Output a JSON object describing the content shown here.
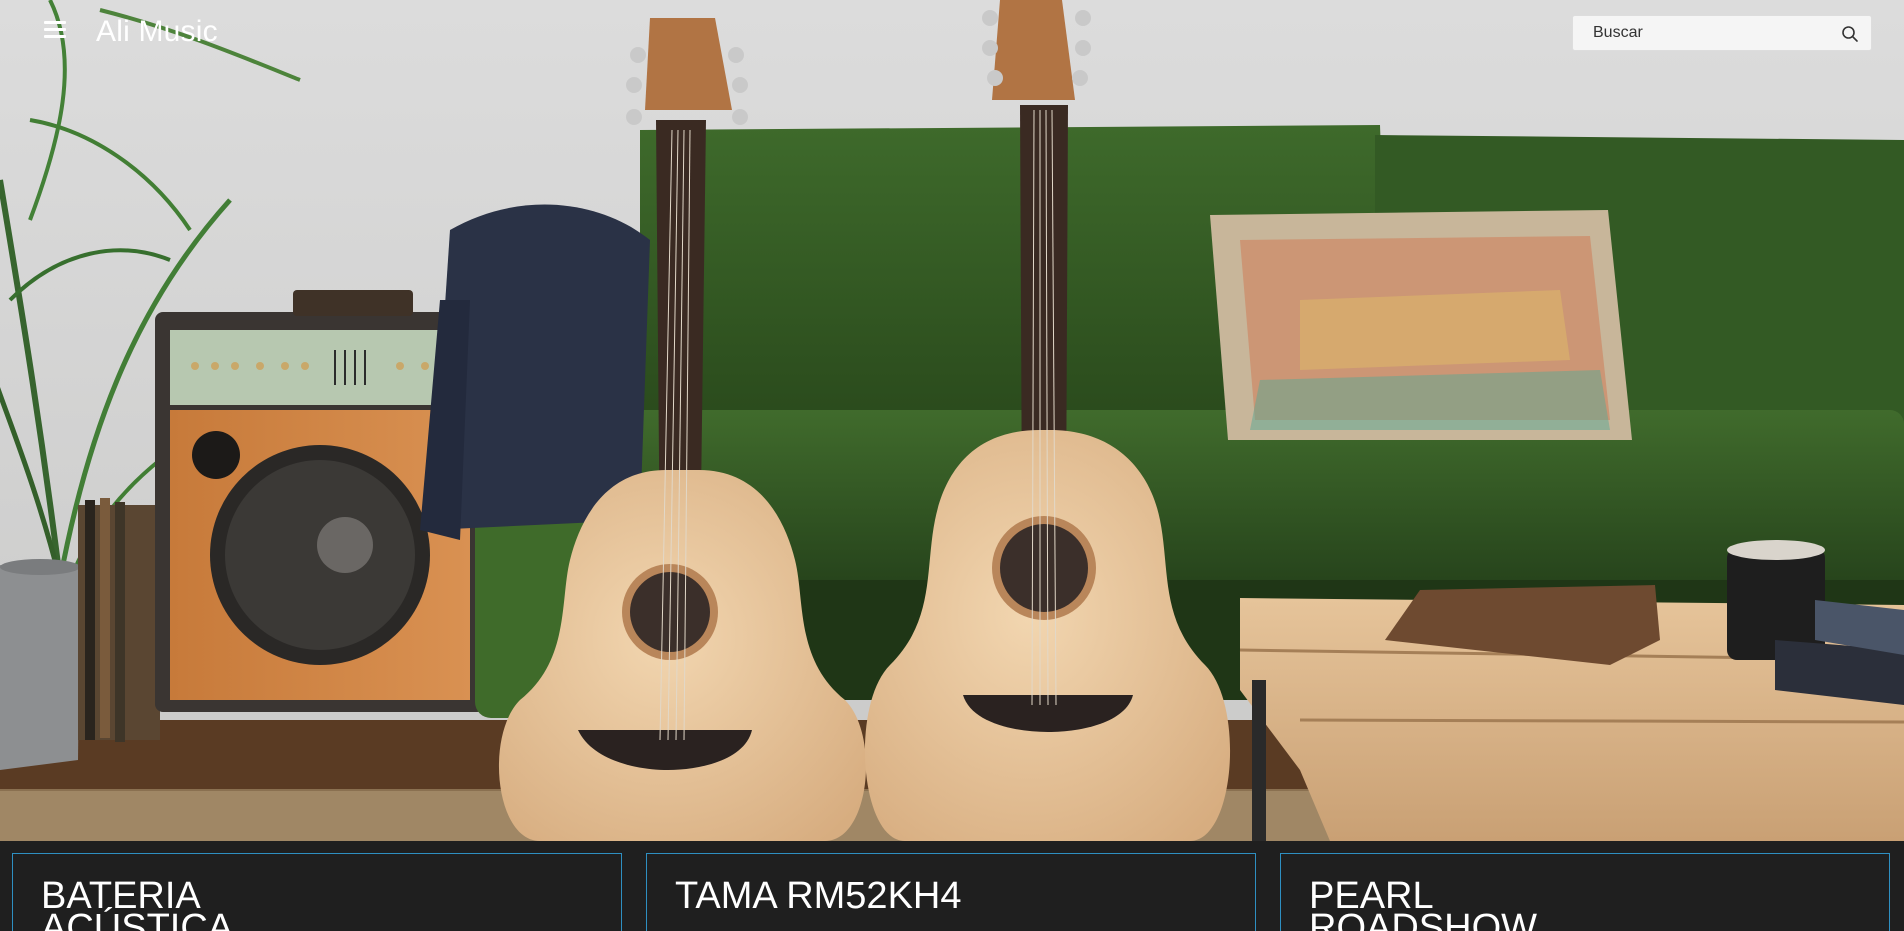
{
  "header": {
    "brand": "Ali Music",
    "menu_icon": "hamburger-menu-icon",
    "search": {
      "placeholder": "Buscar",
      "icon": "search-icon"
    }
  },
  "hero": {
    "image": "guitars-living-room-photo"
  },
  "products": [
    {
      "title": "BATERIA ACÚSTICA"
    },
    {
      "title": "TAMA RM52KH4"
    },
    {
      "title": "PEARL ROADSHOW"
    }
  ],
  "colors": {
    "card_border": "#2e8fc1",
    "card_background": "#1f1f1f",
    "search_background": "#f5f5f5"
  }
}
